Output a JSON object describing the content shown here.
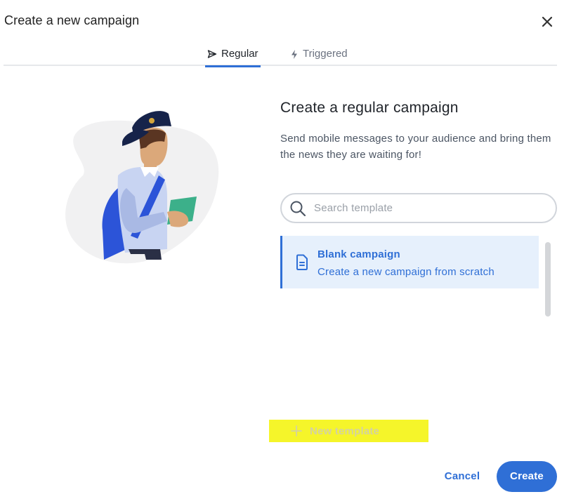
{
  "dialog": {
    "title": "Create a new campaign"
  },
  "tabs": [
    {
      "label": "Regular",
      "icon": "send-icon",
      "active": true
    },
    {
      "label": "Triggered",
      "icon": "lightning-icon",
      "active": false
    }
  ],
  "panel": {
    "title": "Create a regular campaign",
    "description": "Send mobile messages to your audience and bring them the news they are waiting for!"
  },
  "search": {
    "placeholder": "Search template",
    "value": ""
  },
  "templates": [
    {
      "name": "Blank campaign",
      "description": "Create a new campaign from scratch",
      "icon": "document-icon",
      "selected": true
    }
  ],
  "new_template": {
    "label": "New template",
    "icon": "plus-icon"
  },
  "footer": {
    "cancel_label": "Cancel",
    "create_label": "Create"
  },
  "colors": {
    "accent": "#2f6fd6",
    "selected_bg": "#e6f0fc",
    "highlight": "#f5f52a"
  }
}
